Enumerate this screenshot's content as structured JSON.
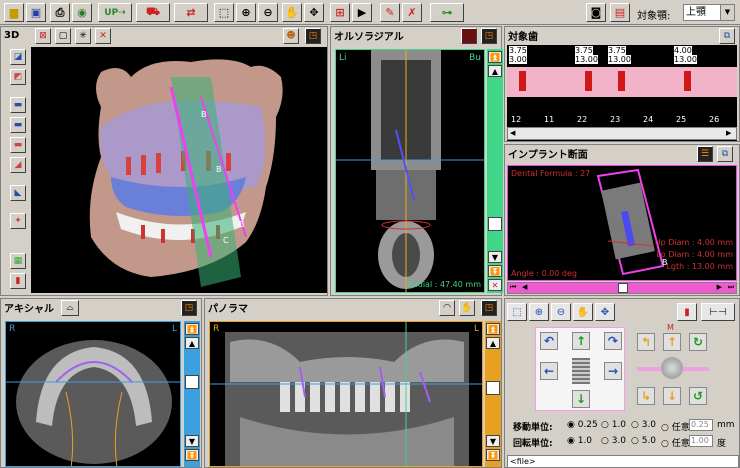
{
  "toolbar": {
    "tooth_type_label": "対象顎:",
    "tooth_type_value": "上顎",
    "icons": [
      "folder-icon",
      "save-icon",
      "print-icon",
      "globe-icon",
      "upload-icon",
      "truck-icon",
      "transfer-icon",
      "zoom-region-icon",
      "zoom-in-icon",
      "zoom-out-icon",
      "hand-icon",
      "move-icon",
      "measure-icon",
      "arrow-icon",
      "edit-icon",
      "delete-icon",
      "implant-icon",
      "camera-icon",
      "settings-icon"
    ]
  },
  "panel_3d": {
    "title": "3D",
    "labels": [
      "B",
      "B",
      "B",
      "C"
    ]
  },
  "panel_ortho": {
    "title": "オルソラジアル",
    "left_label": "Li",
    "right_label": "Bu",
    "radial": "Radial : 47.40 mm"
  },
  "panel_target": {
    "title": "対象歯",
    "teeth": [
      {
        "top": "3.75",
        "bot": "3.00",
        "num": "12"
      },
      {
        "top": "",
        "bot": "",
        "num": "11"
      },
      {
        "top": "3.75",
        "bot": "13.00",
        "num": "22"
      },
      {
        "top": "3.75",
        "bot": "13.00",
        "num": "23"
      },
      {
        "top": "",
        "bot": "",
        "num": "24"
      },
      {
        "top": "4.00",
        "bot": "13.00",
        "num": "25"
      },
      {
        "top": "",
        "bot": "",
        "num": "26"
      }
    ]
  },
  "panel_implant": {
    "title": "インプラント断面",
    "formula": "Dental Formula : 27",
    "up_diam": "Up Diam : 4.00 mm",
    "lo_diam": "Lo Diam : 4.00 mm",
    "length": "Lgth : 13.00 mm",
    "angle": "Angle : 0.00 deg",
    "label_b": "B"
  },
  "panel_axial": {
    "title": "アキシャル",
    "left": "R",
    "right": "L"
  },
  "panel_pano": {
    "title": "パノラマ",
    "left": "R",
    "right": "L"
  },
  "controls": {
    "move_unit_label": "移動単位:",
    "rotate_unit_label": "回転単位:",
    "move_options": [
      "0.25",
      "1.0",
      "3.0",
      "任意"
    ],
    "move_custom": "0.25",
    "move_unit": "mm",
    "rotate_options": [
      "1.0",
      "3.0",
      "5.0",
      "任意"
    ],
    "rotate_custom": "1.00",
    "rotate_unit": "度",
    "m_label": "M",
    "status": "<file>"
  }
}
